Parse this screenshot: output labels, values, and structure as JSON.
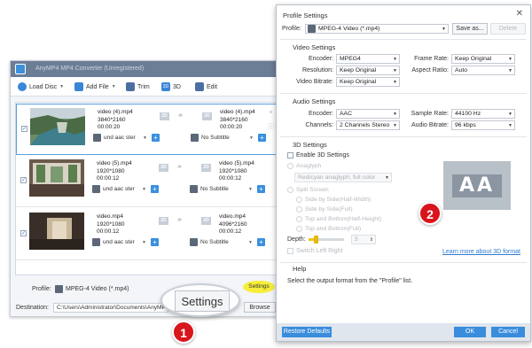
{
  "main_window": {
    "title": "AnyMP4 MP4 Converter (Unregistered)",
    "toolbar": [
      {
        "label": "Load Disc",
        "icon": "load-disc-icon",
        "color": "#3a86d6",
        "has_dropdown": true
      },
      {
        "label": "Add File",
        "icon": "add-file-icon",
        "color": "#3a86d6",
        "has_dropdown": true
      },
      {
        "label": "Trim",
        "icon": "trim-icon",
        "color": "#4b6ea3",
        "has_dropdown": false
      },
      {
        "label": "3D",
        "icon": "3d-icon",
        "color": "#3a86d6",
        "has_dropdown": false
      },
      {
        "label": "Edit",
        "icon": "edit-icon",
        "color": "#4b6ea3",
        "has_dropdown": false
      }
    ],
    "files": [
      {
        "src_name": "video (4).mp4",
        "src_res": "3840*2160",
        "src_dur": "00:00:20",
        "out_name": "video (4).mp4",
        "out_res": "3840*2160",
        "out_dur": "00:00:20",
        "audio": "und aac ster",
        "subtitle": "No Subtitle",
        "badge": "2D",
        "selected": true
      },
      {
        "src_name": "video (5).mp4",
        "src_res": "1920*1080",
        "src_dur": "00:00:12",
        "out_name": "video (5).mp4",
        "out_res": "1920*1080",
        "out_dur": "00:00:12",
        "audio": "und aac ster",
        "subtitle": "No Subtitle",
        "badge": "2D",
        "selected": false
      },
      {
        "src_name": "video.mp4",
        "src_res": "1920*1080",
        "src_dur": "00:00:12",
        "out_name": "video.mp4",
        "out_res": "4096*2160",
        "out_dur": "00:00:12",
        "audio": "und aac ster",
        "subtitle": "No Subtitle",
        "badge": "2D",
        "selected": false
      }
    ],
    "profile_label": "Profile:",
    "profile_value": "MPEG-4 Video (*.mp4)",
    "settings_label": "Settings",
    "destination_label": "Destination:",
    "destination_value": "C:\\Users\\Administrator\\Documents\\AnyMP4",
    "browse_label": "Browse"
  },
  "callout": {
    "settings_zoom_label": "Settings",
    "marker_1": "1",
    "marker_2": "2",
    "highlight_color": "#f6ee3a",
    "marker_color": "#d9141b"
  },
  "dialog": {
    "title": "Profile Settings",
    "close_glyph": "✕",
    "profile_label": "Profile:",
    "profile_value": "MPEG-4 Video (*.mp4)",
    "save_as_label": "Save as...",
    "delete_label": "Delete",
    "video_section": "Video Settings",
    "encoder_label": "Encoder:",
    "encoder_value": "MPEG4",
    "frame_rate_label": "Frame Rate:",
    "frame_rate_value": "Keep Original",
    "resolution_label": "Resolution:",
    "resolution_value": "Keep Original",
    "aspect_ratio_label": "Aspect Ratio:",
    "aspect_ratio_value": "Auto",
    "video_bitrate_label": "Video Bitrate:",
    "video_bitrate_value": "Keep Original",
    "audio_section": "Audio Settings",
    "audio_encoder_label": "Encoder:",
    "audio_encoder_value": "AAC",
    "sample_rate_label": "Sample Rate:",
    "sample_rate_value": "44100 Hz",
    "channels_label": "Channels:",
    "channels_value": "2 Channels Stereo",
    "audio_bitrate_label": "Audio Bitrate:",
    "audio_bitrate_value": "96 kbps",
    "threed_section": "3D Settings",
    "enable_3d_label": "Enable 3D Settings",
    "anaglyph_label": "Anaglyph",
    "anaglyph_value": "Red/cyan anaglyph, full color",
    "split_screen_label": "Split Screen",
    "split_options": [
      "Side by Side(Half-Width)",
      "Side by Side(Full)",
      "Top and Bottom(Half-Height)",
      "Top and Bottom(Full)"
    ],
    "depth_label": "Depth:",
    "depth_value": "5",
    "depth_level": 0.2,
    "switch_lr_label": "Switch Left Right",
    "learn_more_label": "Learn more about 3D format",
    "preview_text": "AA",
    "help_section": "Help",
    "help_text": "Select the output format from the \"Profile\" list.",
    "restore_label": "Restore Defaults",
    "ok_label": "OK",
    "cancel_label": "Cancel"
  }
}
